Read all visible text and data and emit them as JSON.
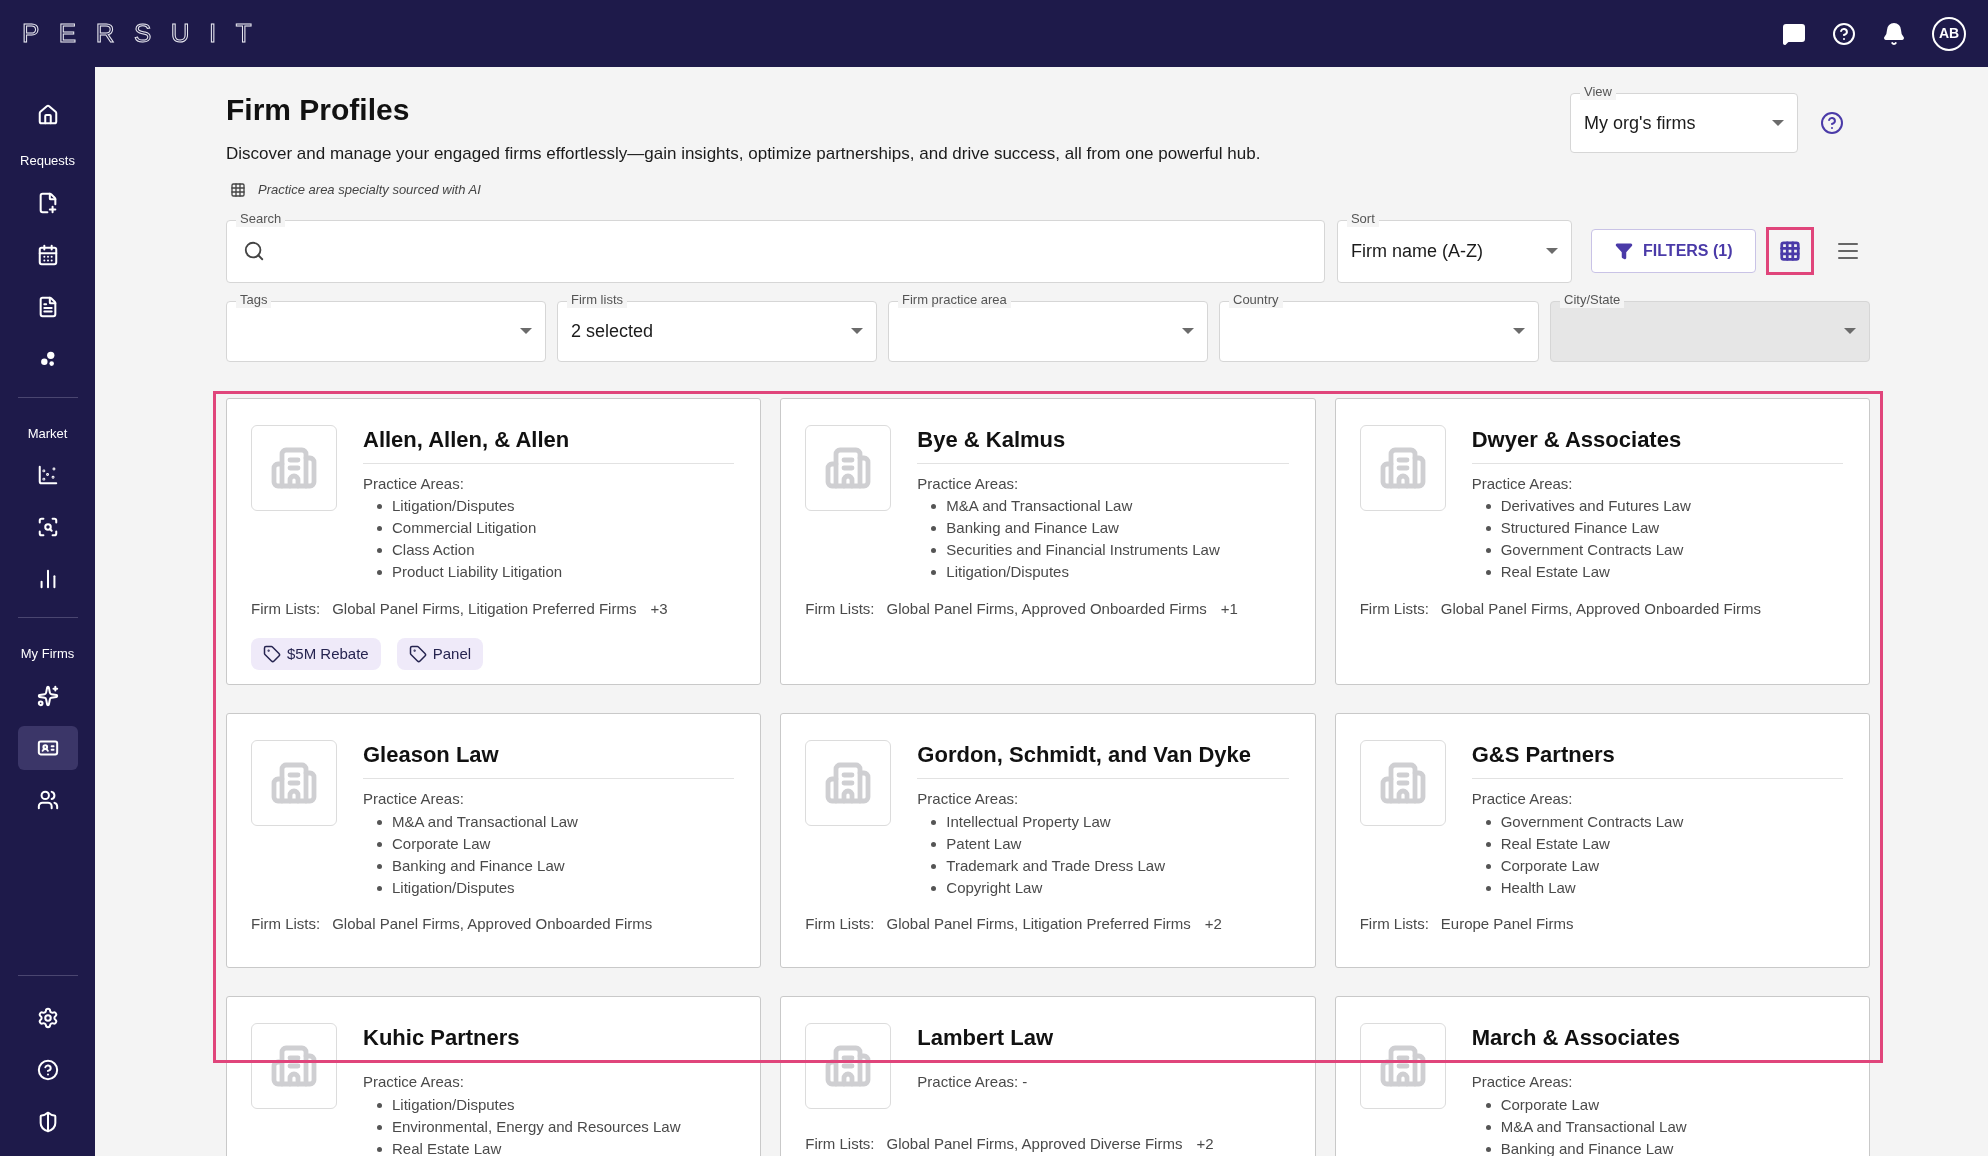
{
  "topbar": {
    "logo": "PERSUIT",
    "avatar": "AB"
  },
  "sidebar": {
    "sections": [
      {
        "items": [
          {
            "selected": false
          }
        ]
      },
      {
        "label": "Requests",
        "items": [
          {
            "selected": false
          },
          {
            "selected": false
          },
          {
            "selected": false
          },
          {
            "selected": false
          }
        ]
      },
      {
        "label": "Market",
        "items": [
          {
            "selected": false
          },
          {
            "selected": false
          },
          {
            "selected": false
          }
        ]
      },
      {
        "label": "My Firms",
        "items": [
          {
            "selected": false
          },
          {
            "selected": true
          },
          {
            "selected": false
          }
        ]
      }
    ],
    "bottom_items": [
      {
        "selected": false
      },
      {
        "selected": false
      },
      {
        "selected": false
      }
    ]
  },
  "page": {
    "title": "Firm Profiles",
    "description": "Discover and manage your engaged firms effortlessly—gain insights, optimize partnerships, and drive success, all from one powerful hub.",
    "ai_note": "Practice area specialty sourced with AI",
    "view": {
      "label": "View",
      "value": "My org's firms"
    },
    "search": {
      "label": "Search"
    },
    "sort": {
      "label": "Sort",
      "value": "Firm name (A-Z)"
    },
    "filters_button": "FILTERS (1)",
    "view_modes": [
      {
        "selected": true
      },
      {
        "selected": false
      }
    ],
    "filters": [
      {
        "label": "Tags",
        "disabled": false
      },
      {
        "label": "Firm lists",
        "value": "2 selected",
        "disabled": false
      },
      {
        "label": "Firm practice area",
        "disabled": false
      },
      {
        "label": "Country",
        "disabled": false
      },
      {
        "label": "City/State",
        "disabled": true
      }
    ]
  },
  "firms": [
    {
      "name": "Allen, Allen, & Allen",
      "practice_label": "Practice Areas:",
      "practice_areas": [
        "Litigation/Disputes",
        "Commercial Litigation",
        "Class Action",
        "Product Liability Litigation"
      ],
      "firm_lists_label": "Firm Lists:",
      "firm_lists": "Global Panel Firms, Litigation Preferred Firms",
      "more": "+3",
      "tags": [
        "$5M Rebate",
        "Panel"
      ]
    },
    {
      "name": "Bye & Kalmus",
      "practice_label": "Practice Areas:",
      "practice_areas": [
        "M&A and Transactional Law",
        "Banking and Finance Law",
        "Securities and Financial Instruments Law",
        "Litigation/Disputes"
      ],
      "firm_lists_label": "Firm Lists:",
      "firm_lists": "Global Panel Firms, Approved Onboarded Firms",
      "more": "+1"
    },
    {
      "name": "Dwyer & Associates",
      "practice_label": "Practice Areas:",
      "practice_areas": [
        "Derivatives and Futures Law",
        "Structured Finance Law",
        "Government Contracts Law",
        "Real Estate Law"
      ],
      "firm_lists_label": "Firm Lists:",
      "firm_lists": "Global Panel Firms, Approved Onboarded Firms"
    },
    {
      "name": "Gleason Law",
      "practice_label": "Practice Areas:",
      "practice_areas": [
        "M&A and Transactional Law",
        "Corporate Law",
        "Banking and Finance Law",
        "Litigation/Disputes"
      ],
      "firm_lists_label": "Firm Lists:",
      "firm_lists": "Global Panel Firms, Approved Onboarded Firms"
    },
    {
      "name": "Gordon, Schmidt, and Van Dyke",
      "practice_label": "Practice Areas:",
      "practice_areas": [
        "Intellectual Property Law",
        "Patent Law",
        "Trademark and Trade Dress Law",
        "Copyright Law"
      ],
      "firm_lists_label": "Firm Lists:",
      "firm_lists": "Global Panel Firms, Litigation Preferred Firms",
      "more": "+2"
    },
    {
      "name": "G&S Partners",
      "practice_label": "Practice Areas:",
      "practice_areas": [
        "Government Contracts Law",
        "Real Estate Law",
        "Corporate Law",
        "Health Law"
      ],
      "firm_lists_label": "Firm Lists:",
      "firm_lists": "Europe Panel Firms"
    },
    {
      "name": "Kuhic Partners",
      "practice_label": "Practice Areas:",
      "practice_areas": [
        "Litigation/Disputes",
        "Environmental, Energy and Resources Law",
        "Real Estate Law"
      ]
    },
    {
      "name": "Lambert Law",
      "practice_label": "Practice Areas: -",
      "firm_lists_label": "Firm Lists:",
      "firm_lists": "Global Panel Firms, Approved Diverse Firms",
      "more": "+2"
    },
    {
      "name": "March & Associates",
      "practice_label": "Practice Areas:",
      "practice_areas": [
        "Corporate Law",
        "M&A and Transactional Law",
        "Banking and Finance Law"
      ]
    }
  ]
}
